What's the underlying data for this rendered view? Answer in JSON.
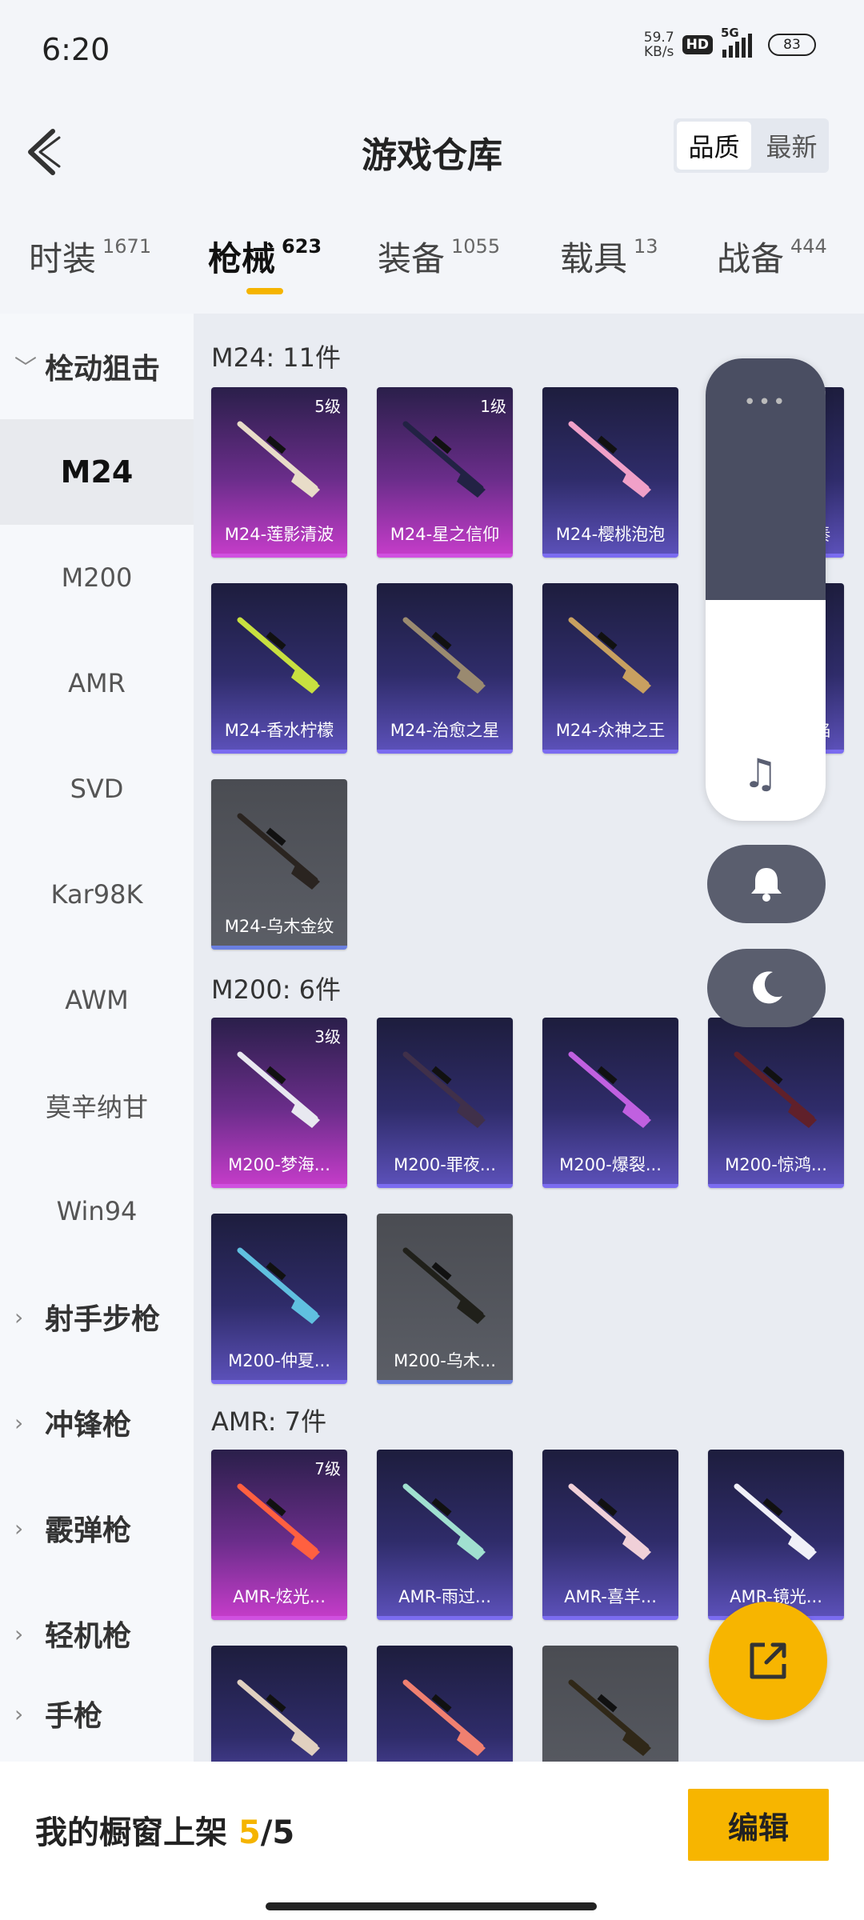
{
  "status": {
    "time": "6:20",
    "net_speed": "59.7",
    "net_unit": "KB/s",
    "hd": "HD",
    "network": "5G",
    "battery": "83"
  },
  "header": {
    "title": "游戏仓库",
    "sort_options": [
      "品质",
      "最新"
    ],
    "sort_selected": "品质"
  },
  "tabs": [
    {
      "label": "时装",
      "count": "1671"
    },
    {
      "label": "枪械",
      "count": "623"
    },
    {
      "label": "装备",
      "count": "1055"
    },
    {
      "label": "载具",
      "count": "13"
    },
    {
      "label": "战备",
      "count": "444"
    }
  ],
  "active_tab": "枪械",
  "sidebar": {
    "group_open": "栓动狙击",
    "items": [
      "M24",
      "M200",
      "AMR",
      "SVD",
      "Kar98K",
      "AWM",
      "莫辛纳甘",
      "Win94"
    ],
    "selected": "M24",
    "groups": [
      "射手步枪",
      "冲锋枪",
      "霰弹枪",
      "轻机枪",
      "手枪"
    ]
  },
  "sections": [
    {
      "title": "M24: 11件",
      "cards": [
        {
          "name": "M24-莲影清波",
          "level": "5级",
          "rarity": "pink"
        },
        {
          "name": "M24-星之信仰",
          "level": "1级",
          "rarity": "pink"
        },
        {
          "name": "M24-樱桃泡泡",
          "level": "",
          "rarity": "blue"
        },
        {
          "name": "M24-炫彩节奏",
          "level": "",
          "rarity": "blue"
        },
        {
          "name": "M24-香水柠檬",
          "level": "",
          "rarity": "blue"
        },
        {
          "name": "M24-治愈之星",
          "level": "",
          "rarity": "blue"
        },
        {
          "name": "M24-众神之王",
          "level": "",
          "rarity": "blue"
        },
        {
          "name": "M24-冰封烈焰",
          "level": "",
          "rarity": "blue"
        },
        {
          "name": "M24-乌木金纹",
          "level": "",
          "rarity": "grey"
        }
      ]
    },
    {
      "title": "M200: 6件",
      "cards": [
        {
          "name": "M200-梦海...",
          "level": "3级",
          "rarity": "pink"
        },
        {
          "name": "M200-罪夜...",
          "level": "",
          "rarity": "blue"
        },
        {
          "name": "M200-爆裂...",
          "level": "",
          "rarity": "blue"
        },
        {
          "name": "M200-惊鸿...",
          "level": "",
          "rarity": "blue"
        },
        {
          "name": "M200-仲夏...",
          "level": "",
          "rarity": "blue"
        },
        {
          "name": "M200-乌木...",
          "level": "",
          "rarity": "grey"
        }
      ]
    },
    {
      "title": "AMR: 7件",
      "cards": [
        {
          "name": "AMR-炫光...",
          "level": "7级",
          "rarity": "pink"
        },
        {
          "name": "AMR-雨过...",
          "level": "",
          "rarity": "blue"
        },
        {
          "name": "AMR-喜羊...",
          "level": "",
          "rarity": "blue"
        },
        {
          "name": "AMR-镜光...",
          "level": "",
          "rarity": "blue"
        },
        {
          "name": "",
          "level": "",
          "rarity": "blue"
        },
        {
          "name": "",
          "level": "",
          "rarity": "blue"
        },
        {
          "name": "",
          "level": "",
          "rarity": "grey"
        }
      ]
    }
  ],
  "overlay": {
    "dots": "•••",
    "music_icon": "music-note-icon",
    "bell_icon": "bell-icon",
    "moon_icon": "moon-icon",
    "share_icon": "share-external-icon"
  },
  "bottom": {
    "showcase_label": "我的橱窗上架",
    "showcase_current": "5",
    "showcase_sep": "/",
    "showcase_total": "5",
    "edit_label": "编辑"
  },
  "colors": {
    "accent": "#f5b400",
    "pink_rarity": "#c33cc8",
    "blue_rarity": "#5b50b8",
    "grey_rarity": "#5b5e66"
  }
}
